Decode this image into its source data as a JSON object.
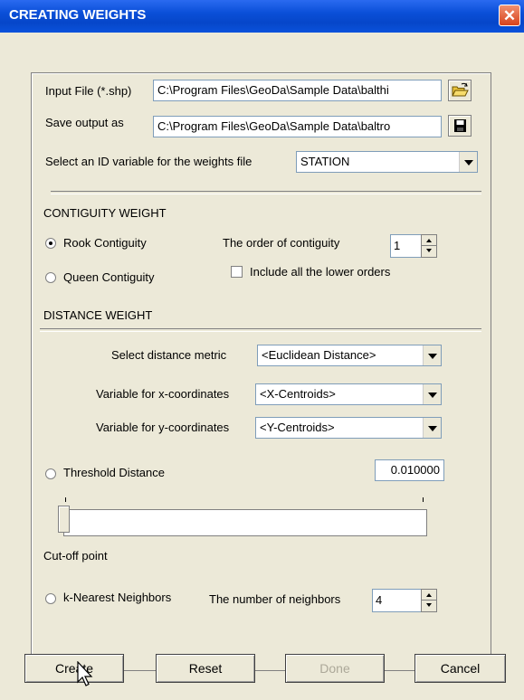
{
  "window": {
    "title": "CREATING WEIGHTS",
    "close_symbol": "✕"
  },
  "input_file": {
    "label": "Input File (*.shp)",
    "value": "C:\\Program Files\\GeoDa\\Sample Data\\balthi"
  },
  "save_output": {
    "label": "Save output as",
    "value": "C:\\Program Files\\GeoDa\\Sample Data\\baltro"
  },
  "id_variable": {
    "label": "Select an ID variable for the weights file",
    "value": "STATION"
  },
  "contiguity": {
    "heading": "CONTIGUITY WEIGHT",
    "rook_label": "Rook Contiguity",
    "queen_label": "Queen Contiguity",
    "order_label": "The order of contiguity",
    "order_value": "1",
    "lower_orders_label": "Include all the lower orders"
  },
  "distance": {
    "heading": "DISTANCE WEIGHT",
    "metric_label": "Select distance metric",
    "metric_value": "<Euclidean Distance>",
    "x_label": "Variable for x-coordinates",
    "x_value": "<X-Centroids>",
    "y_label": "Variable for y-coordinates",
    "y_value": "<Y-Centroids>",
    "threshold_label": "Threshold Distance",
    "threshold_value": "0.010000",
    "cutoff_label": "Cut-off point",
    "knn_label": "k-Nearest Neighbors",
    "neighbors_label": "The number of neighbors",
    "neighbors_value": "4"
  },
  "buttons": {
    "create": "Create",
    "reset": "Reset",
    "done": "Done",
    "cancel": "Cancel"
  }
}
